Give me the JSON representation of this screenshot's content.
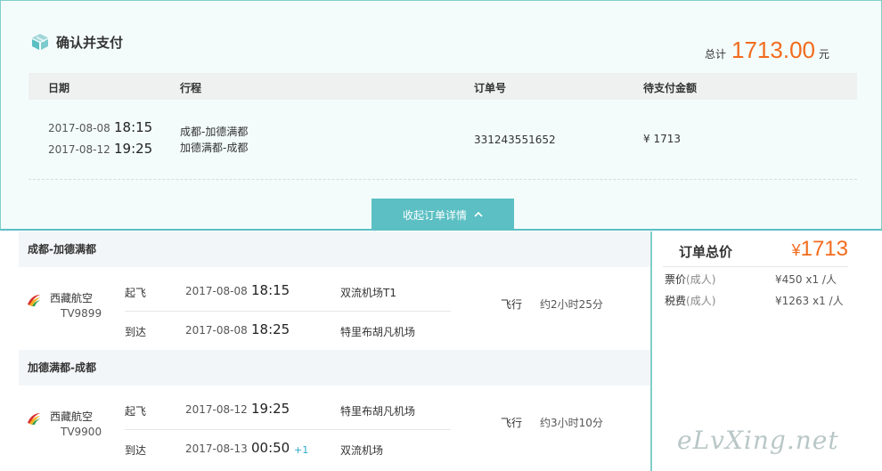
{
  "page": {
    "title": "确认并支付",
    "total_label": "总计",
    "total_amount": "1713.00",
    "total_unit": "元"
  },
  "order_table": {
    "headers": [
      "日期",
      "行程",
      "订单号",
      "待支付金额"
    ],
    "row": {
      "dates": [
        {
          "date": "2017-08-08",
          "time": "18:15"
        },
        {
          "date": "2017-08-12",
          "time": "19:25"
        }
      ],
      "routes": [
        "成都-加德满都",
        "加德满都-成都"
      ],
      "order_no": "331243551652",
      "amount": "¥ 1713"
    }
  },
  "toggle": {
    "label": "收起订单详情",
    "icon": "chevron-up-icon"
  },
  "segments": [
    {
      "title": "成都-加德满都",
      "airline": "西藏航空",
      "flight_no": "TV9899",
      "depart": {
        "label": "起飞",
        "date": "2017-08-08",
        "time": "18:15",
        "airport": "双流机场T1"
      },
      "arrive": {
        "label": "到达",
        "date": "2017-08-08",
        "time": "18:25",
        "airport": "特里布胡凡机场"
      },
      "fly_label": "飞行",
      "duration": "约2小时25分"
    },
    {
      "title": "加德满都-成都",
      "airline": "西藏航空",
      "flight_no": "TV9900",
      "depart": {
        "label": "起飞",
        "date": "2017-08-12",
        "time": "19:25",
        "airport": "特里布胡凡机场"
      },
      "arrive": {
        "label": "到达",
        "date": "2017-08-13",
        "time": "00:50",
        "plus": "+1",
        "airport": "双流机场"
      },
      "fly_label": "飞行",
      "duration": "约3小时10分"
    }
  ],
  "price_summary": {
    "title": "订单总价",
    "currency": "¥",
    "total": "1713",
    "items": [
      {
        "name": "票价",
        "sub": "(成人)",
        "value": "¥450 x1 /人"
      },
      {
        "name": "税费",
        "sub": "(成人)",
        "value": "¥1263 x1 /人"
      }
    ]
  },
  "watermark": "eLvXing.net",
  "colors": {
    "accent_teal": "#5bbfc3",
    "price_orange": "#f26b1d",
    "panel_bg": "#f3fcfb"
  }
}
